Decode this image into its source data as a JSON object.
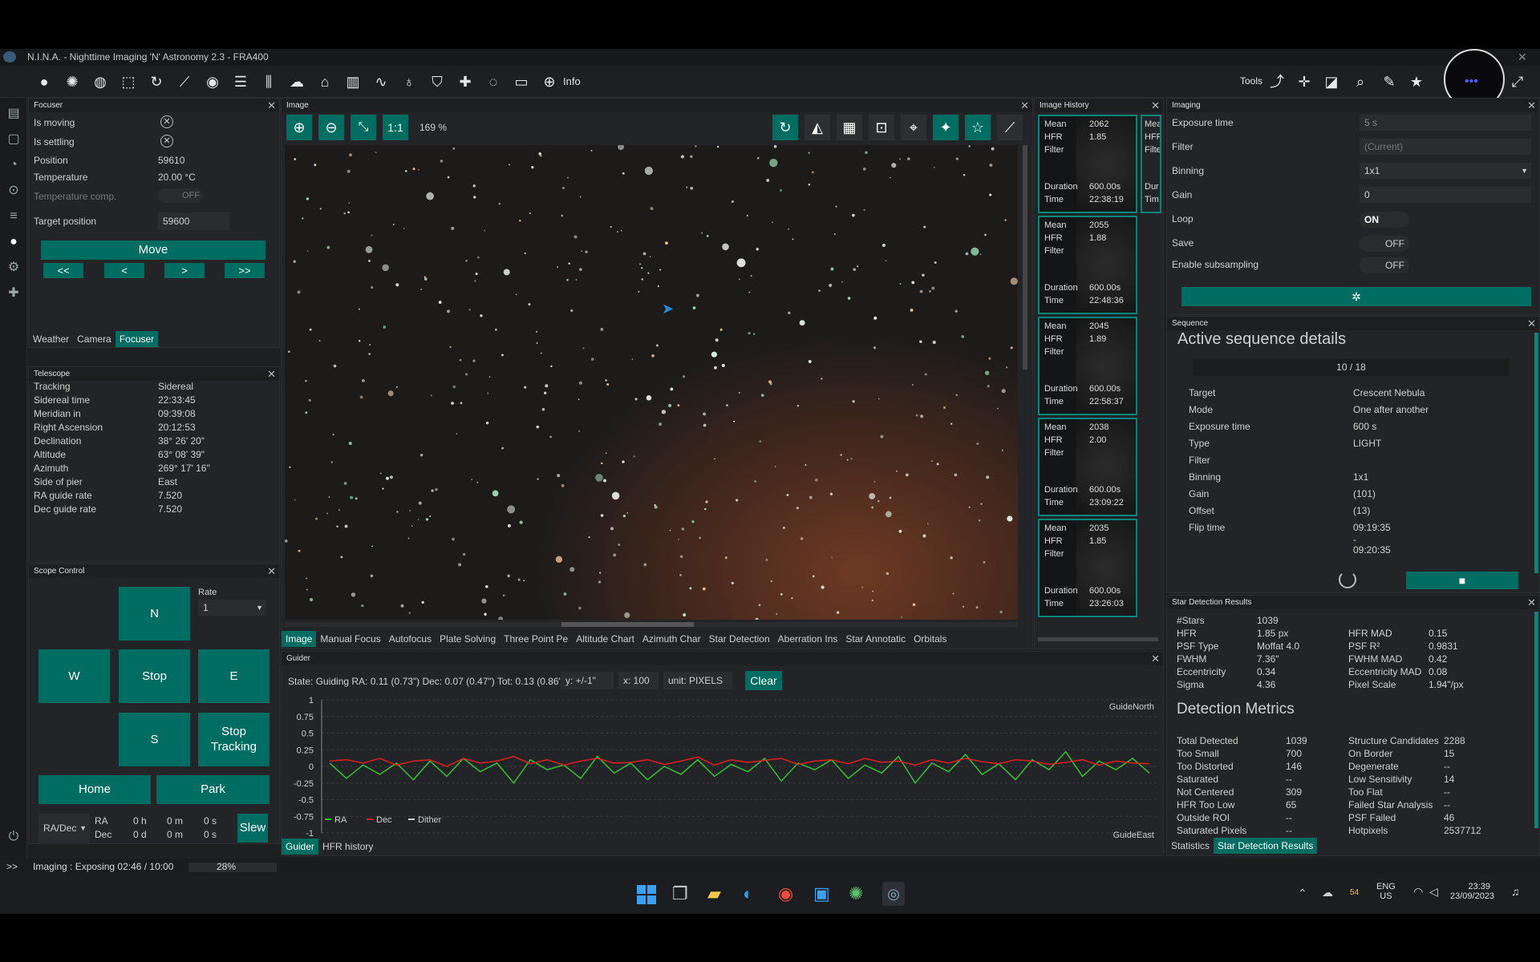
{
  "title": "N.I.N.A. - Nighttime Imaging 'N' Astronomy 2.3  -  FRA400",
  "toolbar": {
    "info": "Info",
    "tools": "Tools"
  },
  "focuser": {
    "header": "Focuser",
    "is_moving": "Is moving",
    "is_settling": "Is settling",
    "position_label": "Position",
    "position": "59610",
    "temperature_label": "Temperature",
    "temperature": "20.00 °C",
    "temp_comp_label": "Temperature comp.",
    "temp_comp": "OFF",
    "target_label": "Target position",
    "target": "59600",
    "move": "Move",
    "b1": "<<",
    "b2": "<",
    "b3": ">",
    "b4": ">>"
  },
  "left_tabs": [
    "Weather",
    "Camera",
    "Focuser"
  ],
  "telescope": {
    "header": "Telescope",
    "rows": [
      [
        "Tracking",
        "Sidereal"
      ],
      [
        "Sidereal time",
        "22:33:45"
      ],
      [
        "Meridian in",
        "09:39:08"
      ],
      [
        "Right Ascension",
        "20:12:53"
      ],
      [
        "Declination",
        "38° 26' 20\""
      ],
      [
        "Altitude",
        "63° 08' 39\""
      ],
      [
        "Azimuth",
        "269° 17' 16\""
      ],
      [
        "Side of pier",
        "East"
      ],
      [
        "RA guide rate",
        "7.520"
      ],
      [
        "Dec guide rate",
        "7.520"
      ]
    ]
  },
  "scope": {
    "header": "Scope Control",
    "rate_label": "Rate",
    "rate": "1",
    "n": "N",
    "w": "W",
    "stop": "Stop",
    "e": "E",
    "s": "S",
    "stop_tracking_1": "Stop",
    "stop_tracking_2": "Tracking",
    "home": "Home",
    "park": "Park",
    "mode": "RA/Dec",
    "ra": "RA",
    "dec": "Dec",
    "ra_h": "0 h",
    "ra_m": "0 m",
    "ra_s": "0 s",
    "dec_d": "0 d",
    "dec_m": "0 m",
    "dec_s": "0 s",
    "slew": "Slew"
  },
  "image": {
    "header": "Image",
    "ratio": "1:1",
    "zoom": "169 %",
    "tabs": [
      "Image",
      "Manual Focus",
      "Autofocus",
      "Plate Solving",
      "Three Point Pe",
      "Altitude Chart",
      "Azimuth Char",
      "Star Detection",
      "Aberration Ins",
      "Star Annotatic",
      "Orbitals"
    ]
  },
  "history": {
    "header": "Image History",
    "items": [
      {
        "mean": "2062",
        "hfr": "1.85",
        "duration": "600.00s",
        "time": "22:38:19"
      },
      {
        "mean": "2055",
        "hfr": "1.88",
        "duration": "600.00s",
        "time": "22:48:36"
      },
      {
        "mean": "2045",
        "hfr": "1.89",
        "duration": "600.00s",
        "time": "22:58:37"
      },
      {
        "mean": "2038",
        "hfr": "2.00",
        "duration": "600.00s",
        "time": "23:09:22"
      },
      {
        "mean": "2035",
        "hfr": "1.85",
        "duration": "600.00s",
        "time": "23:26:03"
      }
    ],
    "l_mean": "Mean",
    "l_hfr": "HFR",
    "l_filter": "Filter",
    "l_duration": "Duration",
    "l_time": "Time",
    "peek": [
      "Mea",
      "HFF",
      "Filte",
      "Dur",
      "Tim"
    ]
  },
  "imaging": {
    "header": "Imaging",
    "exposure_label": "Exposure time",
    "exposure": "5 s",
    "filter_label": "Filter",
    "filter": "(Current)",
    "binning_label": "Binning",
    "binning": "1x1",
    "gain_label": "Gain",
    "gain": "0",
    "loop_label": "Loop",
    "loop": "ON",
    "save_label": "Save",
    "save": "OFF",
    "subs_label": "Enable subsampling",
    "subs": "OFF"
  },
  "sequence": {
    "header": "Sequence",
    "title": "Active sequence details",
    "progress": "10 / 18",
    "rows": [
      [
        "Target",
        "Crescent Nebula"
      ],
      [
        "Mode",
        "One after another"
      ],
      [
        "Exposure time",
        "600 s"
      ],
      [
        "Type",
        "LIGHT"
      ],
      [
        "Filter",
        ""
      ],
      [
        "Binning",
        "1x1"
      ],
      [
        "Gain",
        "(101)"
      ],
      [
        "Offset",
        "(13)"
      ],
      [
        "Flip time",
        "09:19:35"
      ]
    ],
    "flip_dash": "-",
    "flip2": "09:20:35"
  },
  "stars": {
    "header": "Star Detection Results",
    "left": [
      [
        "#Stars",
        "1039"
      ],
      [
        "HFR",
        "1.85 px"
      ],
      [
        "PSF Type",
        "Moffat 4.0"
      ],
      [
        "FWHM",
        "7.36\""
      ],
      [
        "Eccentricity",
        "0.34"
      ],
      [
        "Sigma",
        "4.36"
      ]
    ],
    "right": [
      [
        "HFR MAD",
        "0.15"
      ],
      [
        "PSF R²",
        "0.9831"
      ],
      [
        "FWHM MAD",
        "0.42"
      ],
      [
        "Eccentricity MAD",
        "0.08"
      ],
      [
        "Pixel Scale",
        "1.94\"/px"
      ]
    ],
    "metrics_title": "Detection Metrics",
    "m_left": [
      [
        "Total Detected",
        "1039"
      ],
      [
        "Too Small",
        "700"
      ],
      [
        "Too Distorted",
        "146"
      ],
      [
        "Saturated",
        "--"
      ],
      [
        "Not Centered",
        "309"
      ],
      [
        "HFR Too Low",
        "65"
      ],
      [
        "Outside ROI",
        "--"
      ],
      [
        "Saturated Pixels",
        "--"
      ]
    ],
    "m_right": [
      [
        "Structure Candidates",
        "2288"
      ],
      [
        "On Border",
        "15"
      ],
      [
        "Degenerate",
        "--"
      ],
      [
        "Low Sensitivity",
        "14"
      ],
      [
        "Too Flat",
        "--"
      ],
      [
        "Failed Star Analysis",
        "--"
      ],
      [
        "PSF Failed",
        "46"
      ],
      [
        "Hotpixels",
        "2537712"
      ]
    ],
    "tabs": [
      "Statistics",
      "Star Detection Results"
    ]
  },
  "guider": {
    "header": "Guider",
    "state": "State: Guiding  RA: 0.11 (0.73\")  Dec: 0.07 (0.47\")  Tot: 0.13 (0.86\")",
    "y": "y: +/-1\"",
    "x": "x: 100",
    "unit": "unit: PIXELS",
    "clear": "Clear",
    "yticks": [
      "1",
      "0.75",
      "0.5",
      "0.25",
      "0",
      "-0.25",
      "-0.5",
      "-0.75",
      "-1"
    ],
    "north": "GuideNorth",
    "east": "GuideEast",
    "legend": [
      "RA",
      "Dec",
      "Dither"
    ],
    "tabs": [
      "Guider",
      "HFR history"
    ]
  },
  "status": {
    "prompt": ">>",
    "text": "Imaging :   Exposing 02:46 / 10:00",
    "pct": "28%"
  },
  "taskbar": {
    "lang1": "ENG",
    "lang2": "US",
    "time": "23:39",
    "date": "23/09/2023",
    "temp": "54"
  },
  "colors": {
    "teal": "#006d62",
    "ra": "#34c134",
    "dec": "#e02020"
  },
  "chart_data": {
    "type": "line",
    "title": "",
    "xlabel": "",
    "ylabel": "",
    "ylim": [
      -1,
      1
    ],
    "series": [
      {
        "name": "RA",
        "values": [
          0.05,
          -0.18,
          0.02,
          -0.12,
          0.05,
          -0.2,
          0.08,
          -0.15,
          0.12,
          -0.08,
          0.05,
          -0.25,
          0.1,
          -0.05,
          0.02,
          -0.18,
          0.15,
          -0.1,
          0.05,
          -0.2,
          0.0,
          -0.12,
          0.1,
          -0.15,
          0.03,
          -0.08,
          0.12,
          -0.22,
          0.05,
          -0.05,
          0.1,
          -0.18,
          0.02,
          -0.1,
          0.15,
          -0.25,
          0.05,
          -0.08,
          0.18,
          -0.12,
          0.04,
          -0.2,
          0.1,
          -0.05,
          0.22,
          -0.15,
          0.08,
          -0.05,
          0.12,
          -0.1
        ]
      },
      {
        "name": "Dec",
        "values": [
          0.08,
          0.1,
          0.05,
          0.12,
          0.02,
          0.08,
          0.1,
          0.0,
          0.12,
          0.05,
          0.08,
          0.15,
          0.04,
          0.1,
          0.02,
          0.08,
          0.12,
          0.05,
          0.06,
          0.1,
          0.03,
          0.08,
          0.14,
          0.02,
          0.1,
          0.06,
          0.09,
          0.12,
          0.03,
          0.08,
          0.1,
          0.04,
          0.12,
          0.06,
          0.08,
          0.02,
          0.1,
          0.05,
          0.12,
          0.07,
          0.04,
          0.1,
          0.08,
          0.03,
          0.06,
          0.1,
          0.02,
          0.08,
          0.05,
          0.04
        ]
      }
    ]
  }
}
